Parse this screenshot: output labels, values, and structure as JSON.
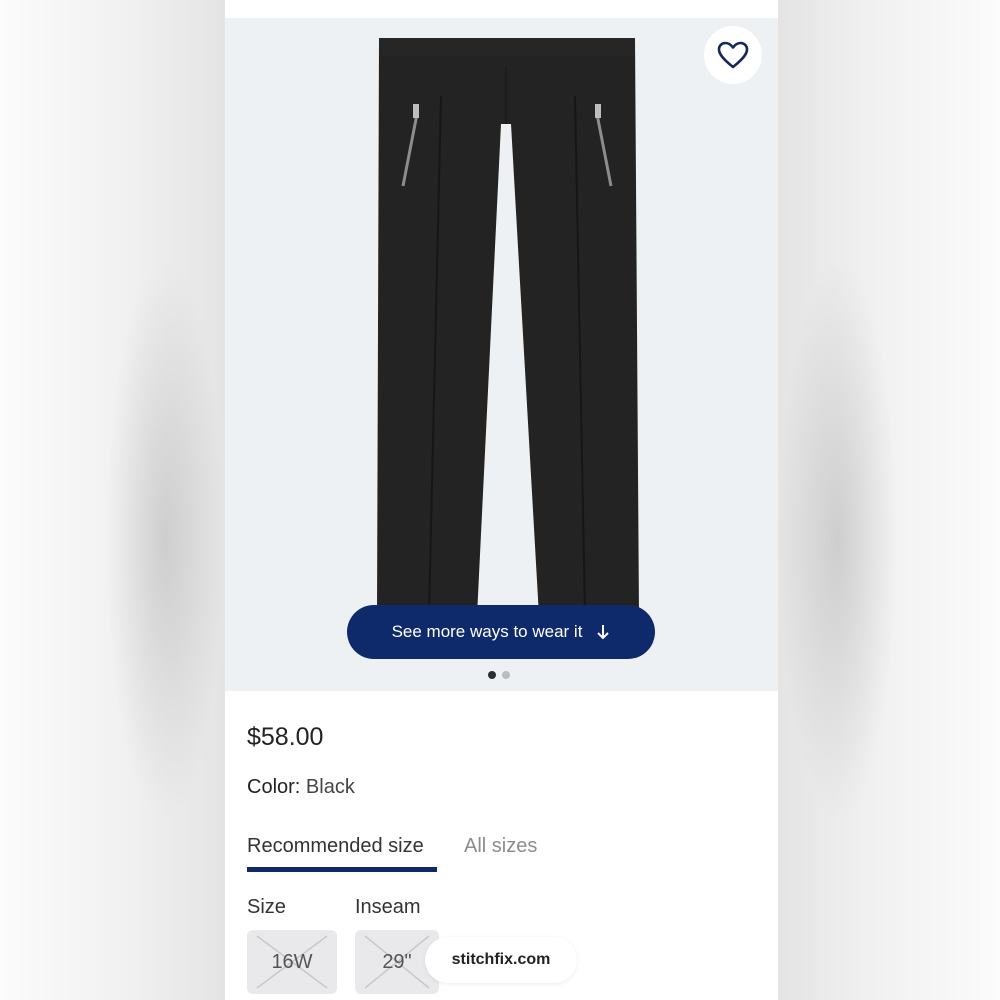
{
  "colors": {
    "accent": "#0f2a6b",
    "hero_bg": "#eef1f4",
    "chip_bg": "#e9e9eb"
  },
  "product": {
    "image_icon": "black-pants-image",
    "favorite_icon": "heart-outline-icon",
    "see_more_label": "See more ways to wear it",
    "see_more_icon": "arrow-down-icon",
    "carousel": {
      "total": 2,
      "active_index": 0
    },
    "price": "$58.00",
    "color_label": "Color:",
    "color_value": "Black"
  },
  "size_tabs": [
    {
      "label": "Recommended size",
      "active": true
    },
    {
      "label": "All sizes",
      "active": false
    }
  ],
  "selectors": {
    "size_label": "Size",
    "size_value": "16W",
    "inseam_label": "Inseam",
    "inseam_value": "29\""
  },
  "watermark": "stitchfix.com"
}
